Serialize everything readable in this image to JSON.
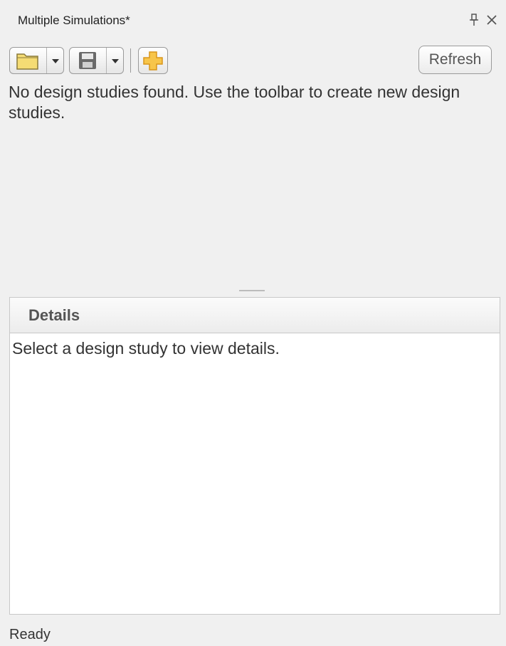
{
  "window": {
    "title": "Multiple Simulations*"
  },
  "toolbar": {
    "open_icon": "folder-open-icon",
    "save_icon": "floppy-save-icon",
    "new_icon": "plus-icon",
    "refresh_label": "Refresh"
  },
  "studies": {
    "empty_message": "No design studies found. Use the toolbar to create new design studies."
  },
  "details": {
    "title": "Details",
    "empty_message": "Select a design study to view details."
  },
  "status": {
    "text": "Ready"
  },
  "colors": {
    "folder": "#f5dc74",
    "plus": "#f7c54a",
    "plus_border": "#d9951a"
  }
}
